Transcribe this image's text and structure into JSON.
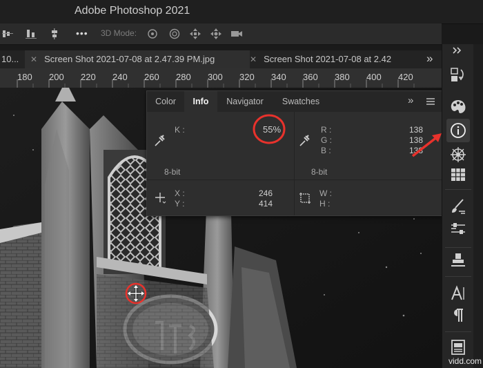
{
  "app": {
    "title": "Adobe Photoshop 2021"
  },
  "options_bar": {
    "mode_label": "3D Mode:",
    "more_label": "•••"
  },
  "tabs": [
    {
      "label": "10...",
      "active": false
    },
    {
      "label": "Screen Shot 2021-07-08 at 2.47.39 PM.jpg",
      "active": true
    },
    {
      "label": "Screen Shot 2021-07-08 at 2.42",
      "active": false
    }
  ],
  "tab_overflow": "»",
  "ruler": {
    "ticks": [
      "180",
      "200",
      "220",
      "240",
      "260",
      "280",
      "300",
      "320",
      "340",
      "360",
      "380",
      "400",
      "420"
    ]
  },
  "info_panel": {
    "tabs": [
      "Color",
      "Info",
      "Navigator",
      "Swatches"
    ],
    "active_tab": "Info",
    "left_readout": {
      "channel": "K :",
      "value": "55%",
      "bit_depth": "8-bit"
    },
    "right_readout": {
      "labels": [
        "R :",
        "G :",
        "B :"
      ],
      "values": [
        "138",
        "138",
        "138"
      ],
      "bit_depth": "8-bit"
    },
    "position": {
      "x_label": "X :",
      "y_label": "Y :",
      "x_value": "246",
      "y_value": "414"
    },
    "size": {
      "w_label": "W :",
      "h_label": "H :"
    }
  },
  "annotation": {
    "highlight_color": "#e8322c"
  },
  "watermark": "vidd.com"
}
